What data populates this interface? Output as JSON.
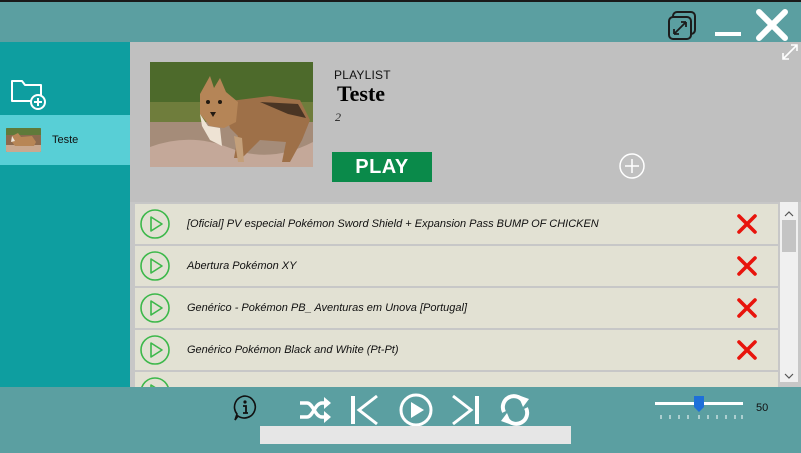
{
  "window": {
    "restore_icon": "restore-window-icon",
    "minimize_icon": "minimize-icon",
    "close_icon": "close-icon"
  },
  "sidebar": {
    "new_playlist_icon": "folder-add-icon",
    "items": [
      {
        "label": "Teste",
        "thumbnail": "wolf-photo"
      }
    ]
  },
  "playlist": {
    "kind": "PLAYLIST",
    "name": "Teste",
    "count": "2",
    "cover": "wolf-photo",
    "play_label": "PLAY",
    "add_icon": "plus-circle-icon",
    "expand_icon": "expand-icon"
  },
  "tracks": [
    {
      "title": "[Oficial] PV especial Pokémon Sword Shield + Expansion Pass  BUMP OF CHICKEN"
    },
    {
      "title": "Abertura Pokémon XY"
    },
    {
      "title": "Genérico - Pokémon PB_ Aventuras em Unova [Portugal]"
    },
    {
      "title": "Genérico Pokémon Black and White  (Pt-Pt)"
    },
    {
      "title": ""
    }
  ],
  "player": {
    "info_icon": "info-icon",
    "shuffle_icon": "shuffle-icon",
    "previous_icon": "skip-previous-icon",
    "play_icon": "play-circle-icon",
    "next_icon": "skip-next-icon",
    "repeat_icon": "repeat-icon",
    "progress": 0,
    "volume": 50,
    "volume_label": "50"
  },
  "colors": {
    "teal_frame": "#5b9fa1",
    "sidebar": "#0e9ea0",
    "sidebar_selected": "#58cfd6",
    "play_button": "#0a8a4a",
    "track_icon": "#3cb84a",
    "delete": "#e8140c",
    "volume_knob": "#1e6fd9"
  }
}
